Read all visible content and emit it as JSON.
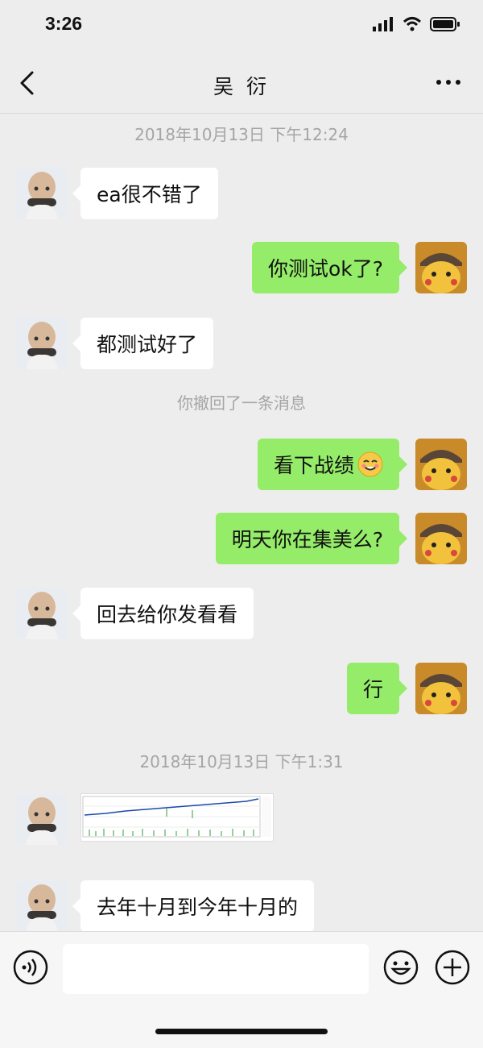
{
  "status": {
    "time": "3:26"
  },
  "header": {
    "title": "吴 衍"
  },
  "messages": {
    "ts1": "2018年10月13日 下午12:24",
    "m1": "ea很不错了",
    "m2": "你测试ok了?",
    "m3": "都测试好了",
    "recall": "你撤回了一条消息",
    "m4": "看下战绩",
    "m5": "明天你在集美么?",
    "m6": "回去给你发看看",
    "m7": "行",
    "ts2": "2018年10月13日 下午1:31",
    "m8": "去年十月到今年十月的"
  },
  "colors": {
    "outgoing_bubble": "#95ec69",
    "incoming_bubble": "#ffffff",
    "background": "#ededed"
  },
  "icons": {
    "back": "chevron-left-icon",
    "more": "more-dots-icon",
    "voice": "voice-icon",
    "emoji": "emoji-icon",
    "plus": "plus-icon"
  }
}
